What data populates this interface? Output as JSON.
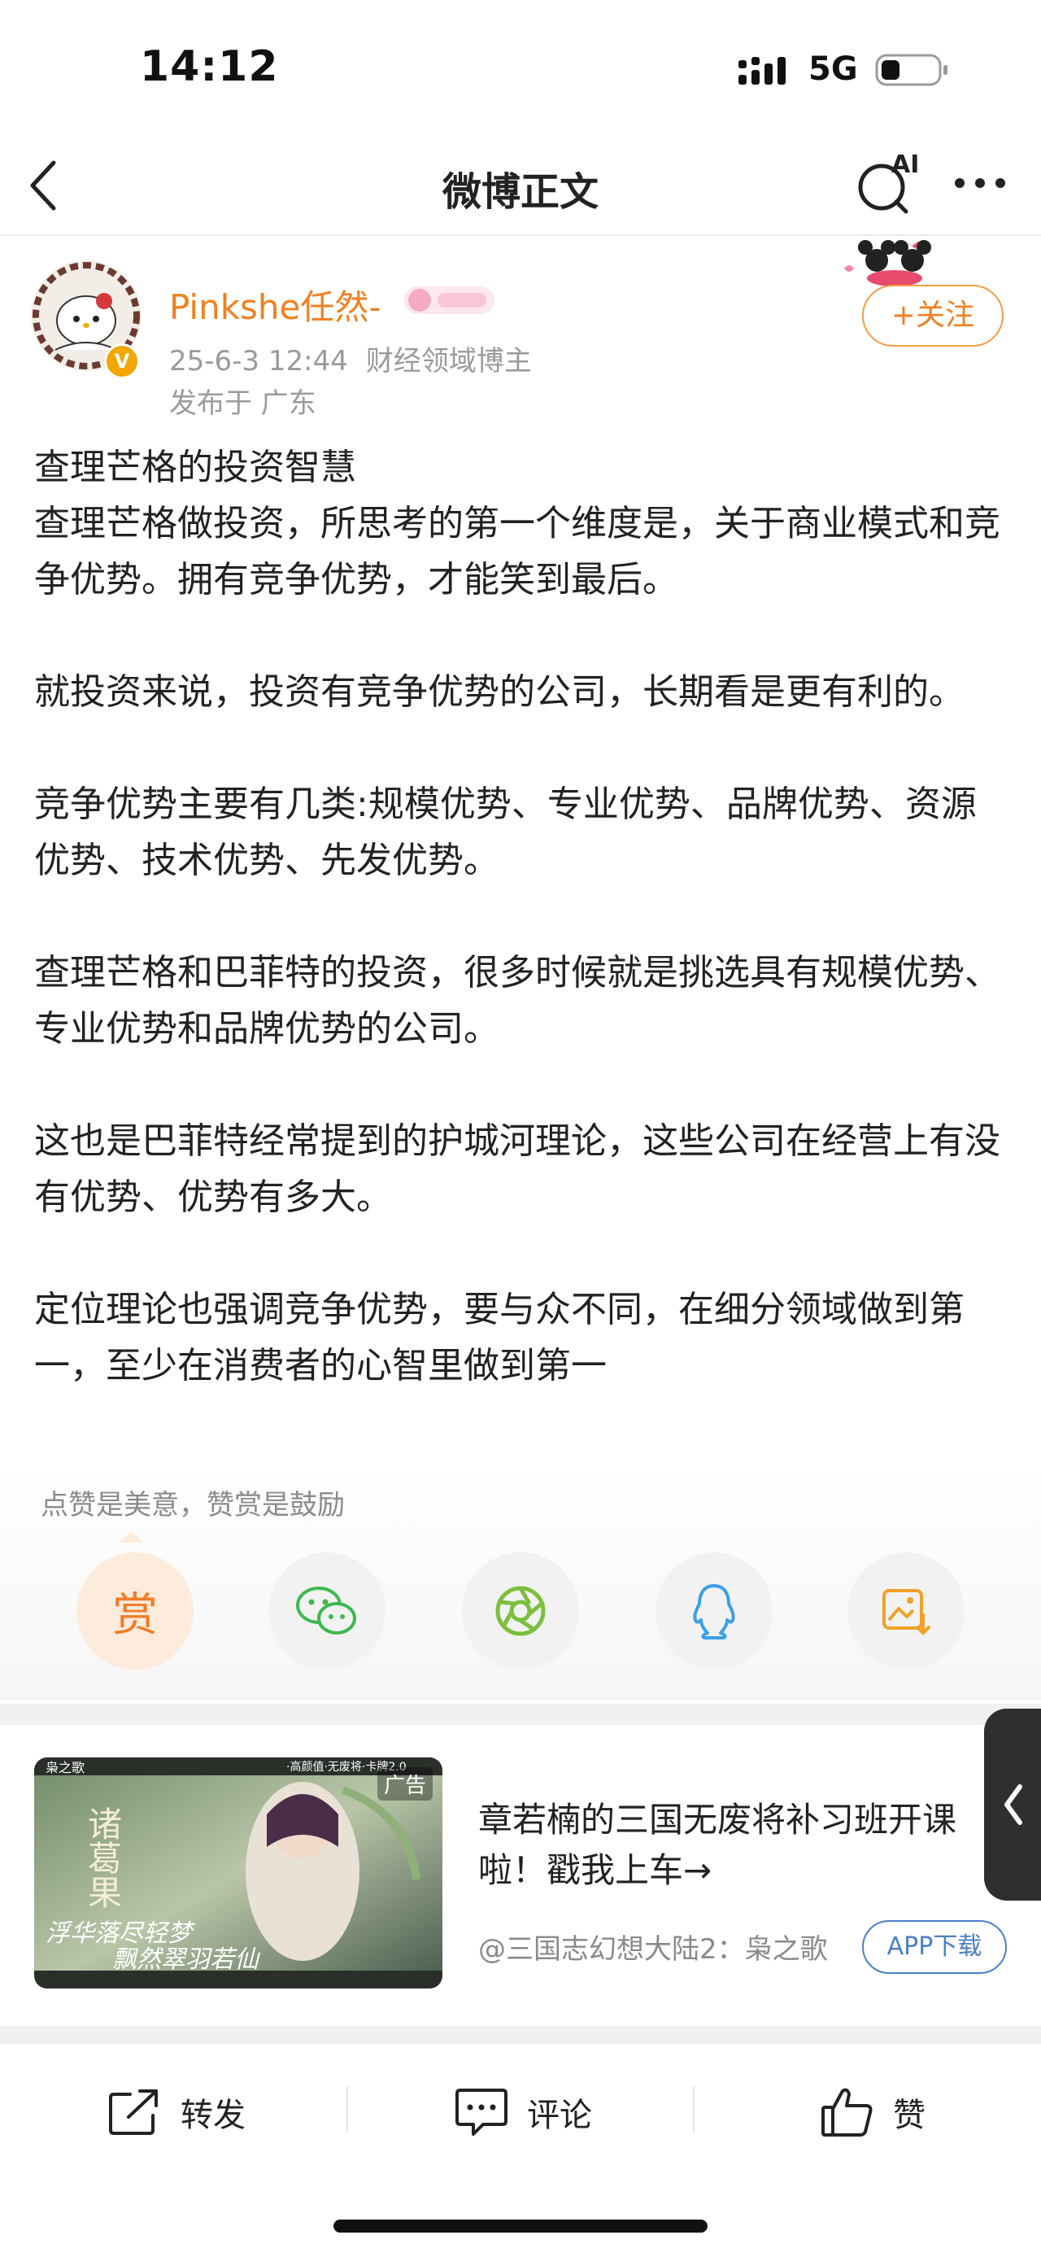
{
  "status_bar": {
    "time": "14:12",
    "network": "5G"
  },
  "nav": {
    "title": "微博正文",
    "ai_label": "AI"
  },
  "author": {
    "name": "Pinkshe任然-",
    "date": "25-6-3 12:44",
    "category": "财经领域博主",
    "location": "发布于 广东",
    "verified_badge": "V",
    "follow_label": "+关注"
  },
  "post": {
    "body": "查理芒格的投资智慧\n查理芒格做投资，所思考的第一个维度是，关于商业模式和竞争优势。拥有竞争优势，才能笑到最后。\n\n就投资来说，投资有竞争优势的公司，长期看是更有利的。\n\n竞争优势主要有几类:规模优势、专业优势、品牌优势、资源优势、技术优势、先发优势。\n\n查理芒格和巴菲特的投资，很多时候就是挑选具有规模优势、专业优势和品牌优势的公司。\n\n这也是巴菲特经常提到的护城河理论，这些公司在经营上有没有优势、优势有多大。\n\n定位理论也强调竞争优势，要与众不同，在细分领域做到第一，至少在消费者的心智里做到第一"
  },
  "reward": {
    "tip": "点赞是美意，赞赏是鼓励",
    "reward_label": "赏",
    "buttons": [
      "wechat-icon",
      "moments-icon",
      "qq-icon",
      "save-image-icon"
    ]
  },
  "ad": {
    "label": "广告",
    "title": "章若楠的三国无废将补习班开课啦！戳我上车→",
    "source": "@三国志幻想大陆2：枭之歌",
    "button": "APP下载",
    "image_text": {
      "logo": "枭之歌",
      "slogan": "·高颜值·无废将·卡牌2.0",
      "name": "诸葛果",
      "verse1": "浮华落尽轻梦",
      "verse2": "飘然翠羽若仙"
    }
  },
  "toolbar": {
    "repost": "转发",
    "comment": "评论",
    "like": "赞"
  },
  "colors": {
    "accent": "#f08020",
    "link": "#4a7fc8",
    "meta": "#9a9a9a"
  }
}
